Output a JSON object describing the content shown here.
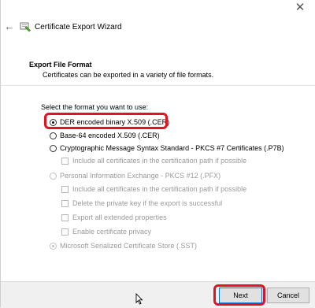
{
  "window": {
    "title": "Certificate Export Wizard",
    "close_glyph": "✕",
    "back_glyph": "←"
  },
  "header": {
    "title": "Export File Format",
    "description": "Certificates can be exported in a variety of file formats."
  },
  "prompt": "Select the format you want to use:",
  "options": {
    "der": "DER encoded binary X.509 (.CER)",
    "base64": "Base-64 encoded X.509 (.CER)",
    "pkcs7": "Cryptographic Message Syntax Standard - PKCS #7 Certificates (.P7B)",
    "pkcs7_include": "Include all certificates in the certification path if possible",
    "pfx": "Personal Information Exchange - PKCS #12 (.PFX)",
    "pfx_include": "Include all certificates in the certification path if possible",
    "pfx_delete_key": "Delete the private key if the export is successful",
    "pfx_export_props": "Export all extended properties",
    "pfx_privacy": "Enable certificate privacy",
    "sst": "Microsoft Serialized Certificate Store (.SST)"
  },
  "selected_option": "der",
  "buttons": {
    "next": "Next",
    "cancel": "Cancel"
  },
  "colors": {
    "highlight": "#e0141e",
    "default_button_border": "#0078d7",
    "footer_bg": "#f0f0f0"
  }
}
